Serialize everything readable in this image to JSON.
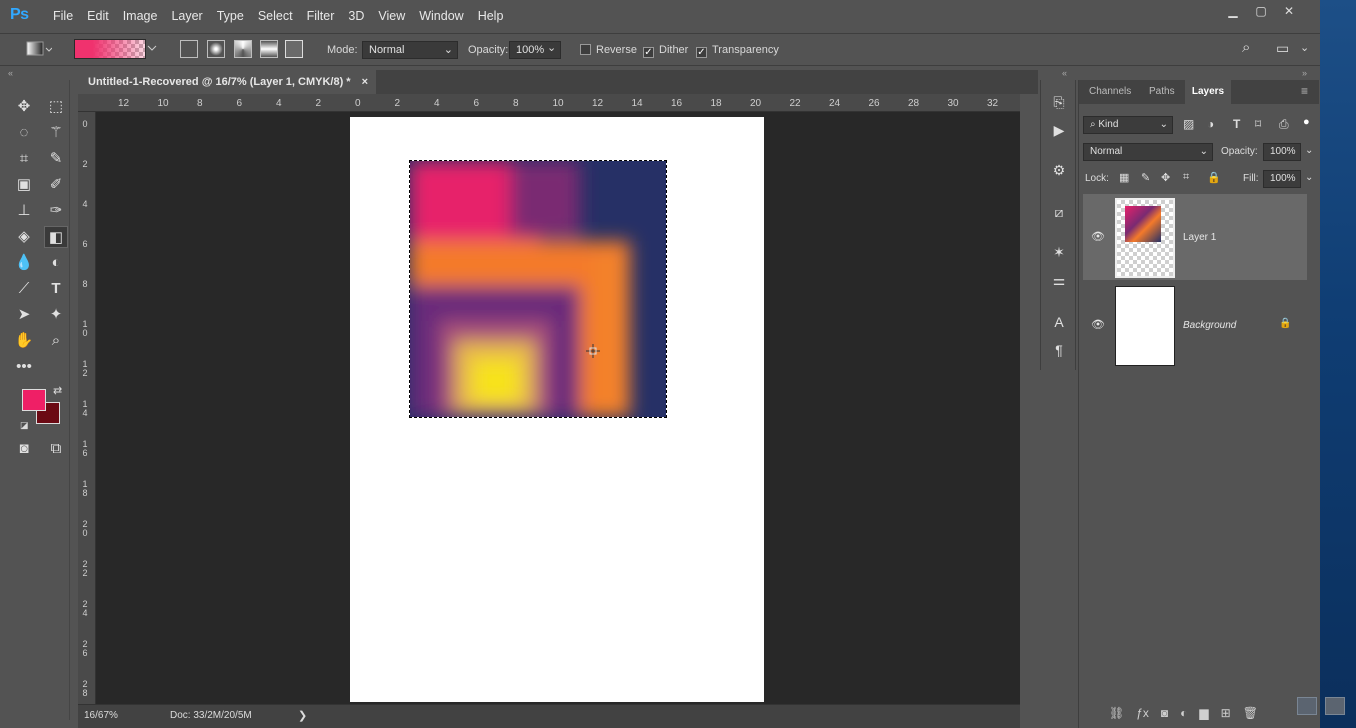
{
  "app": {
    "logo": "Ps",
    "menu": [
      "File",
      "Edit",
      "Image",
      "Layer",
      "Type",
      "Select",
      "Filter",
      "3D",
      "View",
      "Window",
      "Help"
    ],
    "window_controls": [
      "minimize-icon",
      "restore-icon",
      "close-icon"
    ]
  },
  "options_bar": {
    "mode_label": "Mode:",
    "mode_value": "Normal",
    "opacity_label": "Opacity:",
    "opacity_value": "100%",
    "reverse_label": "Reverse",
    "dither_label": "Dither",
    "transparency_label": "Transparency",
    "reverse_checked": false,
    "dither_checked": true,
    "transparency_checked": true
  },
  "document": {
    "tab_title": "Untitled-1-Recovered @ 16/7% (Layer 1, CMYK/8) *",
    "tab_close": "×",
    "ruler_top": [
      "12",
      "10",
      "8",
      "6",
      "4",
      "2",
      "0",
      "2",
      "4",
      "6",
      "8",
      "10",
      "12",
      "14",
      "16",
      "18",
      "20",
      "22",
      "24",
      "26",
      "28",
      "30",
      "32"
    ],
    "ruler_left": [
      "0",
      "2",
      "4",
      "6",
      "8",
      "1\n0",
      "1\n2",
      "1\n4",
      "1\n6",
      "1\n8",
      "2\n0",
      "2\n2",
      "2\n4",
      "2\n6",
      "2\n8"
    ],
    "zoom": "16/67%",
    "doc_info": "Doc: 33/2M/20/5M",
    "status_arrow": "❯"
  },
  "colors": {
    "foreground": "#ef1f66",
    "background": "#6b0a14",
    "accent": "#31a8ff"
  },
  "layers_panel": {
    "tabs": [
      "Channels",
      "Paths",
      "Layers"
    ],
    "filter_kind": "Kind",
    "blend_mode": "Normal",
    "opacity_label": "Opacity:",
    "opacity_value": "100%",
    "lock_label": "Lock:",
    "fill_label": "Fill:",
    "fill_value": "100%",
    "layers": [
      {
        "name": "Layer 1",
        "visible": true,
        "locked": false,
        "selected": true
      },
      {
        "name": "Background",
        "visible": true,
        "locked": true,
        "selected": false
      }
    ]
  },
  "tools": [
    "move-tool",
    "marquee-tool",
    "lasso-tool",
    "magic-wand-tool",
    "crop-tool",
    "eyedropper-tool",
    "frame-tool",
    "brush-tool",
    "stamp-tool",
    "history-brush-tool",
    "eraser-tool",
    "gradient-tool",
    "blur-tool",
    "dodge-tool",
    "pen-tool",
    "type-tool",
    "path-select-tool",
    "shape-tool",
    "hand-tool",
    "zoom-tool",
    "more-tools"
  ]
}
